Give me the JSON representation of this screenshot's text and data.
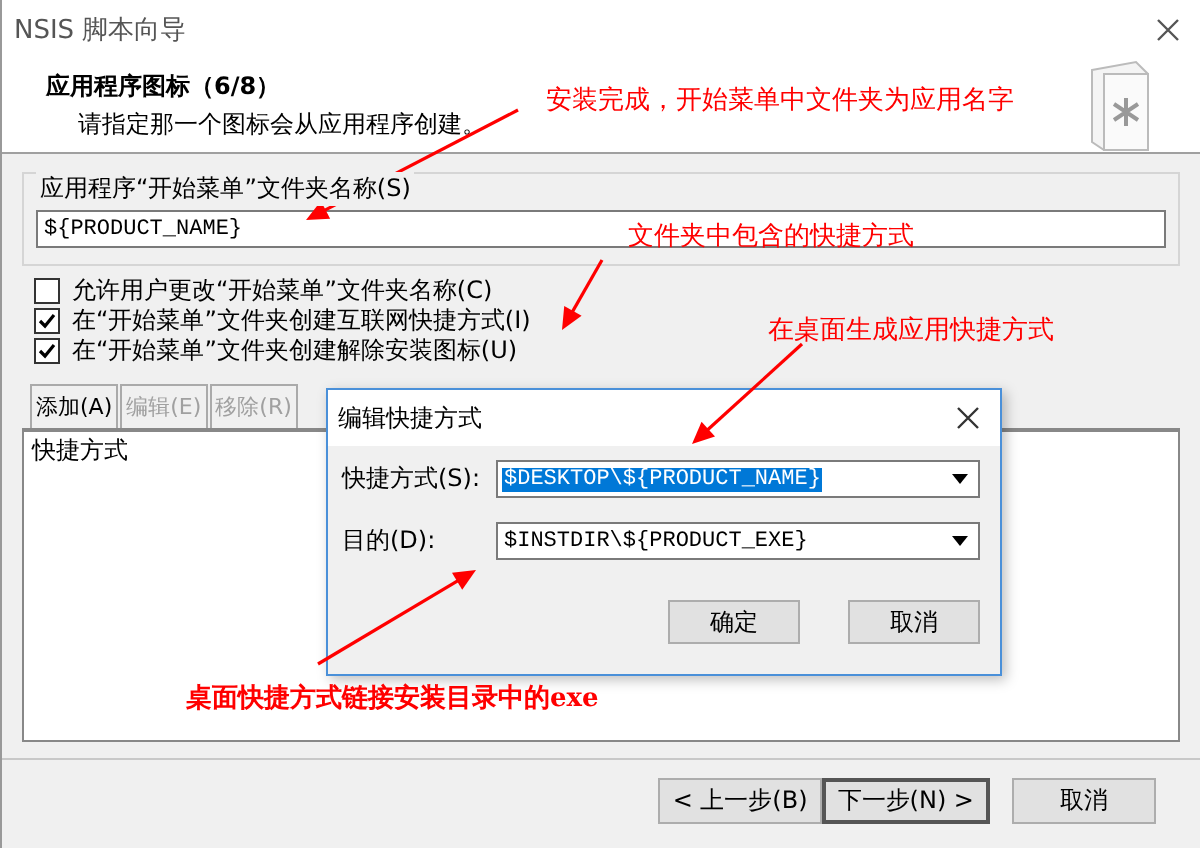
{
  "window": {
    "title": "NSIS 脚本向导"
  },
  "header": {
    "title": "应用程序图标（6/8）",
    "subtitle": "请指定那一个图标会从应用程序创建。"
  },
  "folder_group": {
    "label": "应用程序“开始菜单”文件夹名称(S)",
    "value": "${PRODUCT_NAME}"
  },
  "options": [
    {
      "label": "允许用户更改“开始菜单”文件夹名称(C)",
      "checked": false
    },
    {
      "label": "在“开始菜单”文件夹创建互联网快捷方式(I)",
      "checked": true
    },
    {
      "label": "在“开始菜单”文件夹创建解除安装图标(U)",
      "checked": true
    }
  ],
  "shortcut_tabs": [
    {
      "label": "添加(A)",
      "disabled": false
    },
    {
      "label": "编辑(E)",
      "disabled": true
    },
    {
      "label": "移除(R)",
      "disabled": true
    }
  ],
  "shortcut_list": {
    "column": "快捷方式"
  },
  "dialog": {
    "title": "编辑快捷方式",
    "fields": [
      {
        "label": "快捷方式(S):",
        "value": "$DESKTOP\\${PRODUCT_NAME}",
        "selected": true
      },
      {
        "label": "目的(D):",
        "value": "$INSTDIR\\${PRODUCT_EXE}",
        "selected": false
      }
    ],
    "buttons": [
      "确定",
      "取消"
    ]
  },
  "nav_buttons": [
    {
      "label": "< 上一步(B)",
      "default": false
    },
    {
      "label": "下一步(N) >",
      "default": true
    },
    {
      "label": "取消",
      "default": false
    }
  ],
  "annotations": [
    {
      "text": "安装完成，开始菜单中文件夹为应用名字",
      "bold": false
    },
    {
      "text": "文件夹中包含的快捷方式",
      "bold": false
    },
    {
      "text": "在桌面生成应用快捷方式",
      "bold": false
    },
    {
      "text": "桌面快捷方式链接安装目录中的exe",
      "bold": true
    }
  ]
}
